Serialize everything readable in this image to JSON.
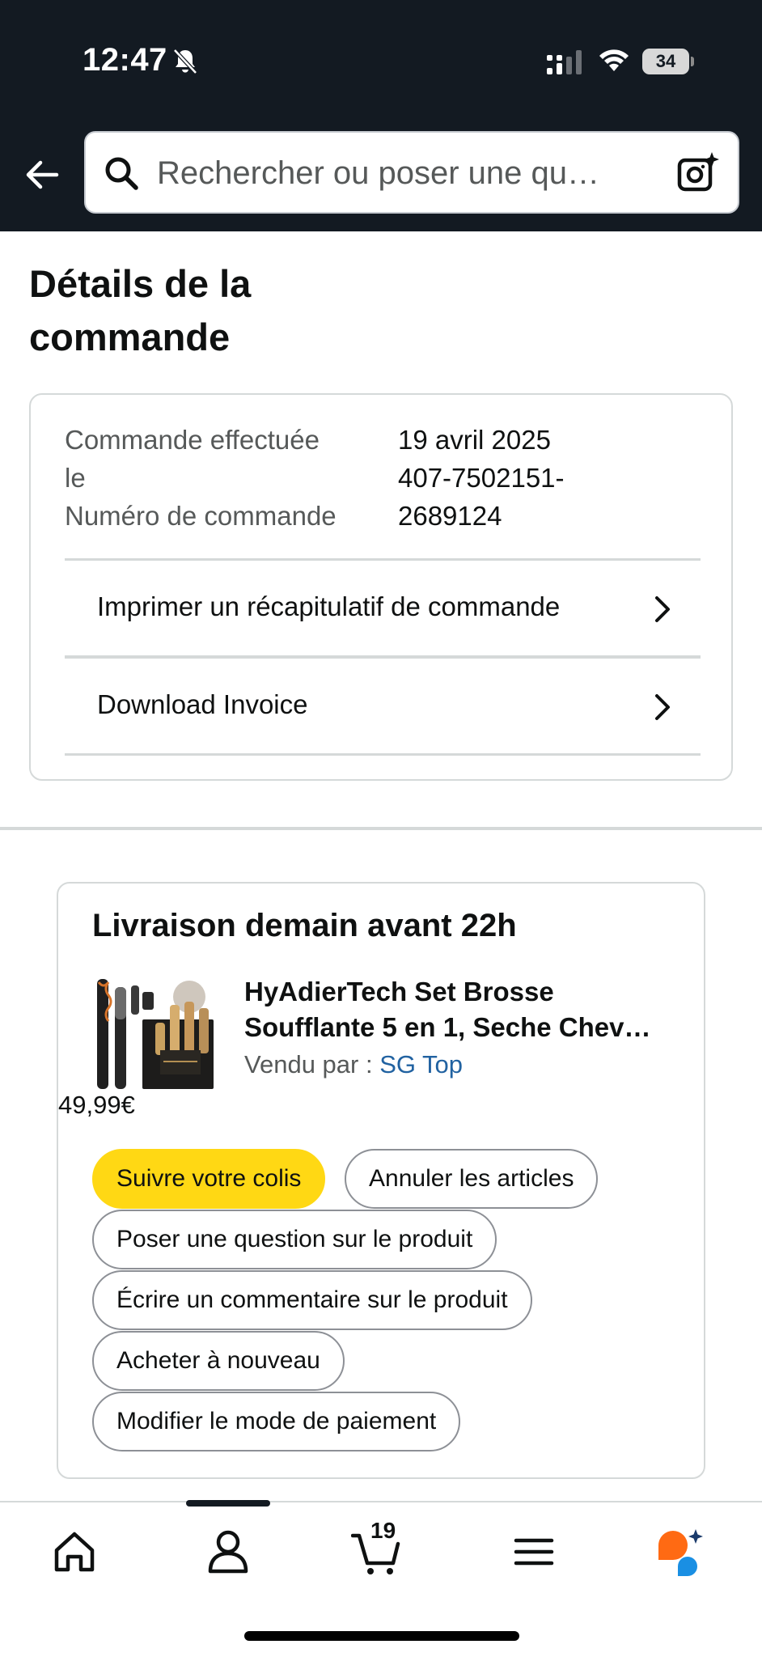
{
  "status_bar": {
    "time": "12:47",
    "battery": "34"
  },
  "search": {
    "placeholder": "Rechercher ou poser une qu…"
  },
  "page": {
    "title_line1": "Détails de la",
    "title_line2": "commande"
  },
  "order": {
    "placed_label": "Commande effectuée",
    "placed_label_cont": "le",
    "number_label": "Numéro de commande",
    "placed_date": "19 avril 2025",
    "number_part1": "407-7502151-",
    "number_part2": "2689124",
    "links": [
      {
        "label": "Imprimer un récapitulatif de commande"
      },
      {
        "label": "Download Invoice"
      }
    ]
  },
  "shipment": {
    "delivery_text": "Livraison demain avant 22h",
    "product_name_line1": "HyAdierTech Set Brosse",
    "product_name_line2": "Soufflante 5 en 1, Seche Chev…",
    "sold_by_label": "Vendu par  :",
    "seller": "SG Top",
    "price": "49,99€",
    "actions": [
      "Suivre votre colis",
      "Annuler les articles",
      "Poser une question sur le produit",
      "Écrire un commentaire sur le produit",
      "Acheter à nouveau",
      "Modifier le mode de paiement"
    ]
  },
  "bottom_nav": {
    "items": [
      "home-icon",
      "account-icon",
      "cart-icon",
      "menu-icon",
      "rufus-icon"
    ],
    "cart_count": "19"
  },
  "colors": {
    "header_bg": "#131a22",
    "primary_button": "#ffd814",
    "link": "#2162a1",
    "rufus_orange": "#ff6a13",
    "rufus_blue": "#1a8fe3"
  }
}
